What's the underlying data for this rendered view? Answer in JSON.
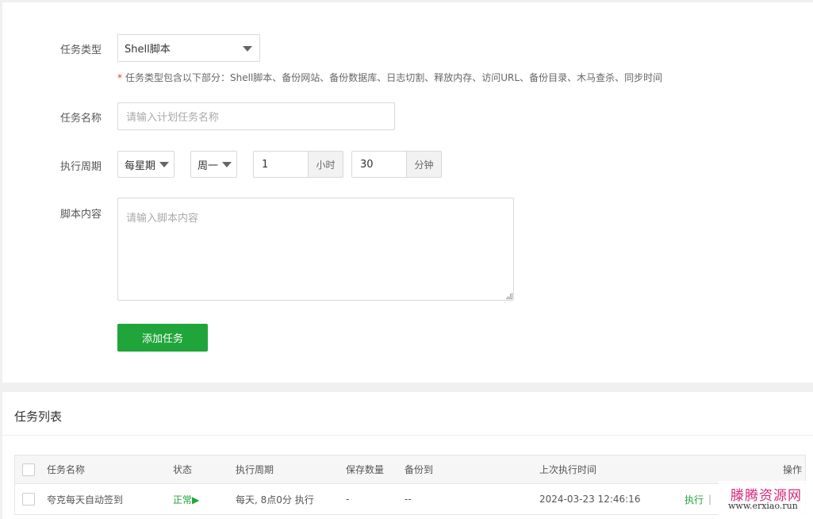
{
  "form": {
    "task_type": {
      "label": "任务类型",
      "value": "Shell脚本"
    },
    "hint": "任务类型包含以下部分：Shell脚本、备份网站、备份数据库、日志切割、释放内存、访问URL、备份目录、木马查杀、同步时间",
    "hint_star": "*",
    "task_name": {
      "label": "任务名称",
      "placeholder": "请输入计划任务名称"
    },
    "cycle": {
      "label": "执行周期",
      "period": "每星期",
      "weekday": "周一",
      "hour": "1",
      "hour_unit": "小时",
      "minute": "30",
      "minute_unit": "分钟"
    },
    "script": {
      "label": "脚本内容",
      "placeholder": "请输入脚本内容"
    },
    "add_button": "添加任务"
  },
  "list": {
    "title": "任务列表",
    "columns": [
      "任务名称",
      "状态",
      "执行周期",
      "保存数量",
      "备份到",
      "上次执行时间",
      "操作"
    ],
    "rows": [
      {
        "name": "夸克每天自动签到",
        "status": "正常▶",
        "cycle": "每天, 8点0分 执行",
        "keep": "-",
        "backup_to": "--",
        "last_run": "2024-03-23 12:46:16",
        "action": "执行",
        "separator": "|"
      }
    ]
  },
  "watermark": {
    "title": "滕腾资源网",
    "url": "www.erxiao.run"
  },
  "colors": {
    "accent": "#20a53a",
    "required": "#e4393c",
    "watermark": "#d6287a"
  }
}
